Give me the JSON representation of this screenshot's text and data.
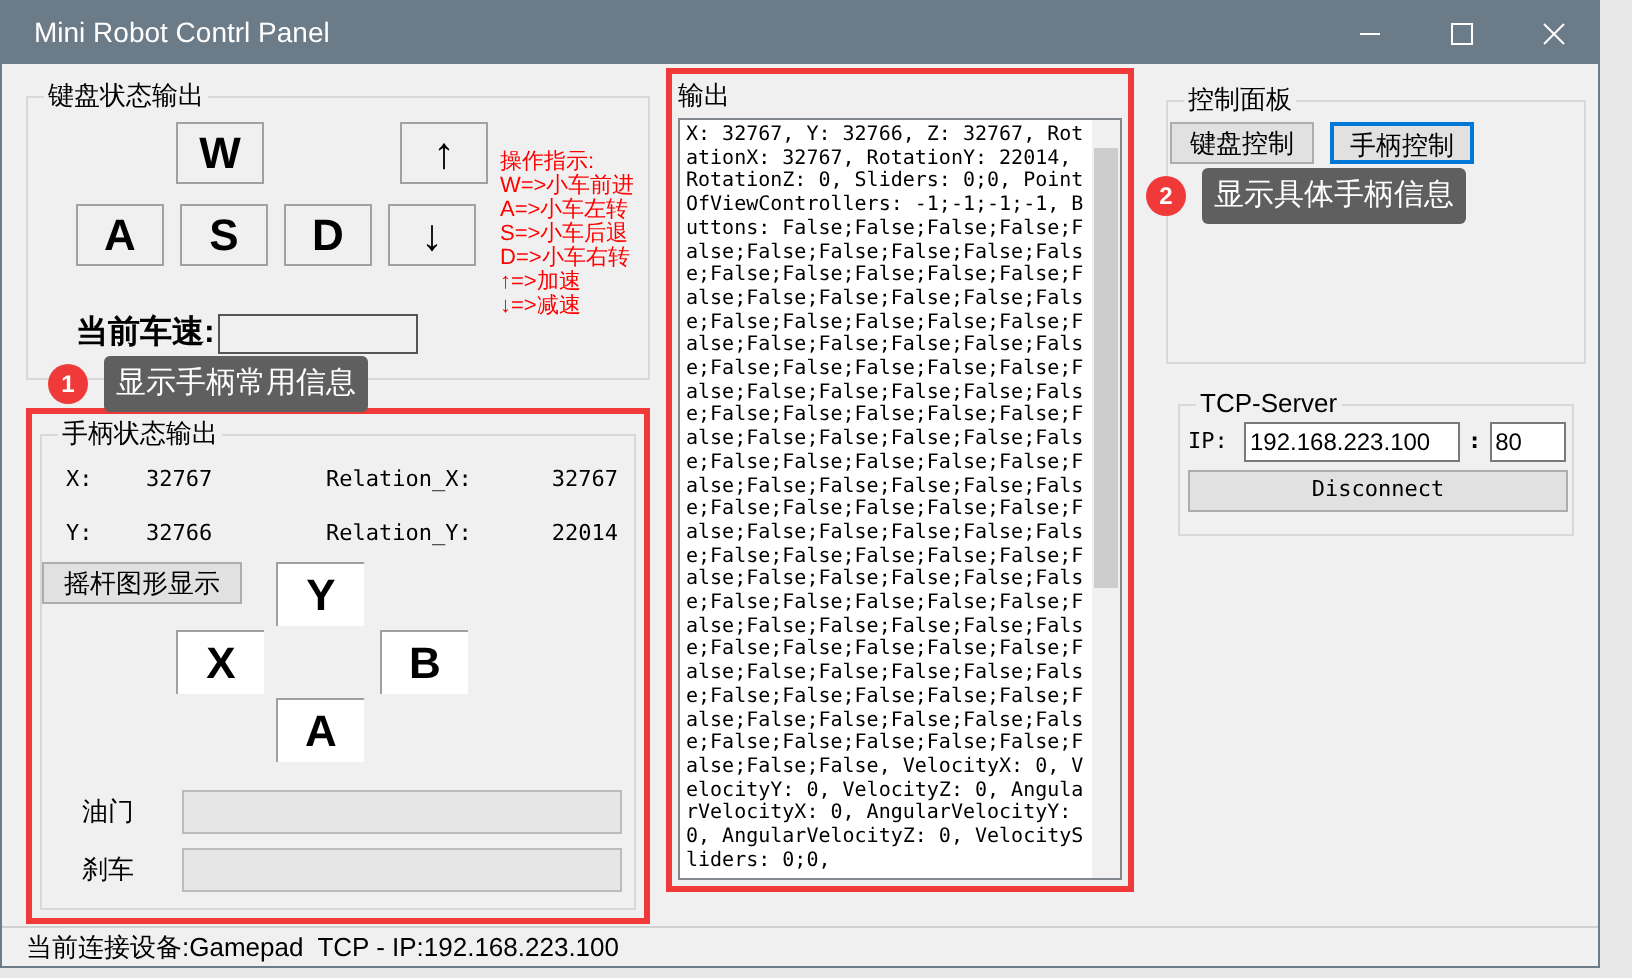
{
  "window": {
    "title": "Mini Robot Contrl Panel"
  },
  "keyboard_group": {
    "title": "键盘状态输出",
    "keys": [
      {
        "label": "W",
        "pressed": false
      },
      {
        "label": "↑",
        "pressed": false
      },
      {
        "label": "A",
        "pressed": false
      },
      {
        "label": "S",
        "pressed": false
      },
      {
        "label": "D",
        "pressed": false
      },
      {
        "label": "↓",
        "pressed": false
      }
    ],
    "instructions": [
      "操作指示:",
      "W=>小车前进",
      "A=>小车左转",
      "S=>小车后退",
      "D=>小车右转",
      "↑=>加速",
      "↓=>减速"
    ],
    "speed_label": "当前车速:"
  },
  "callouts": [
    {
      "number": "1",
      "text": "显示手柄常用信息"
    },
    {
      "number": "2",
      "text": "显示具体手柄信息"
    }
  ],
  "gamepad_group": {
    "title": "手柄状态输出",
    "readings": [
      {
        "label": "X:",
        "value": "32767",
        "relation_label": "Relation_X:",
        "relation_value": "32767"
      },
      {
        "label": "Y:",
        "value": "32766",
        "relation_label": "Relation_Y:",
        "relation_value": "22014"
      }
    ],
    "stick_button": "摇杆图形显示",
    "buttons": [
      {
        "label": "Y",
        "pressed": false
      },
      {
        "label": "X",
        "pressed": false
      },
      {
        "label": "B",
        "pressed": false
      },
      {
        "label": "A",
        "pressed": false
      }
    ],
    "bars": [
      {
        "label": "油门",
        "level": 0
      },
      {
        "label": "刹车",
        "level": 0
      }
    ]
  },
  "output": {
    "title": "输出",
    "text": "X: 32767, Y: 32766, Z: 32767, RotationX: 32767, RotationY: 22014, RotationZ: 0, Sliders: 0;0, PointOfViewControllers: -1;-1;-1;-1, Buttons: False;False;False;False;False;False;False;False;False;False;False;False;False;False;False;False;False;False;False;False;False;False;False;False;False;False;False;False;False;False;False;False;False;False;False;False;False;False;False;False;False;False;False;False;False;False;False;False;False;False;False;False;False;False;False;False;False;False;False;False;False;False;False;False;False;False;False;False;False;False;False;False;False;False;False;False;False;False;False;False;False;False;False;False;False;False;False;False;False;False;False;False;False;False;False;False;False;False;False;False;False;False;False;False;False;False;False;False;False;False;False;False;False;False;False;False;False;False;False;False;False;False;False;False;False;False;False;False, VelocityX: 0, VelocityY: 0, VelocityZ: 0, AngularVelocityX: 0, AngularVelocityY: 0, AngularVelocityZ: 0, VelocitySliders: 0;0,"
  },
  "control_panel": {
    "title": "控制面板",
    "modes": [
      {
        "label": "键盘控制",
        "selected": false
      },
      {
        "label": "手柄控制",
        "selected": true
      }
    ]
  },
  "tcp_server": {
    "title": "TCP-Server",
    "ip_label": "IP:",
    "ip": "192.168.223.100",
    "separator": ":",
    "port": "80",
    "button": "Disconnect"
  },
  "status_bar": {
    "text": "当前连接设备:Gamepad  TCP - IP:192.168.223.100"
  }
}
